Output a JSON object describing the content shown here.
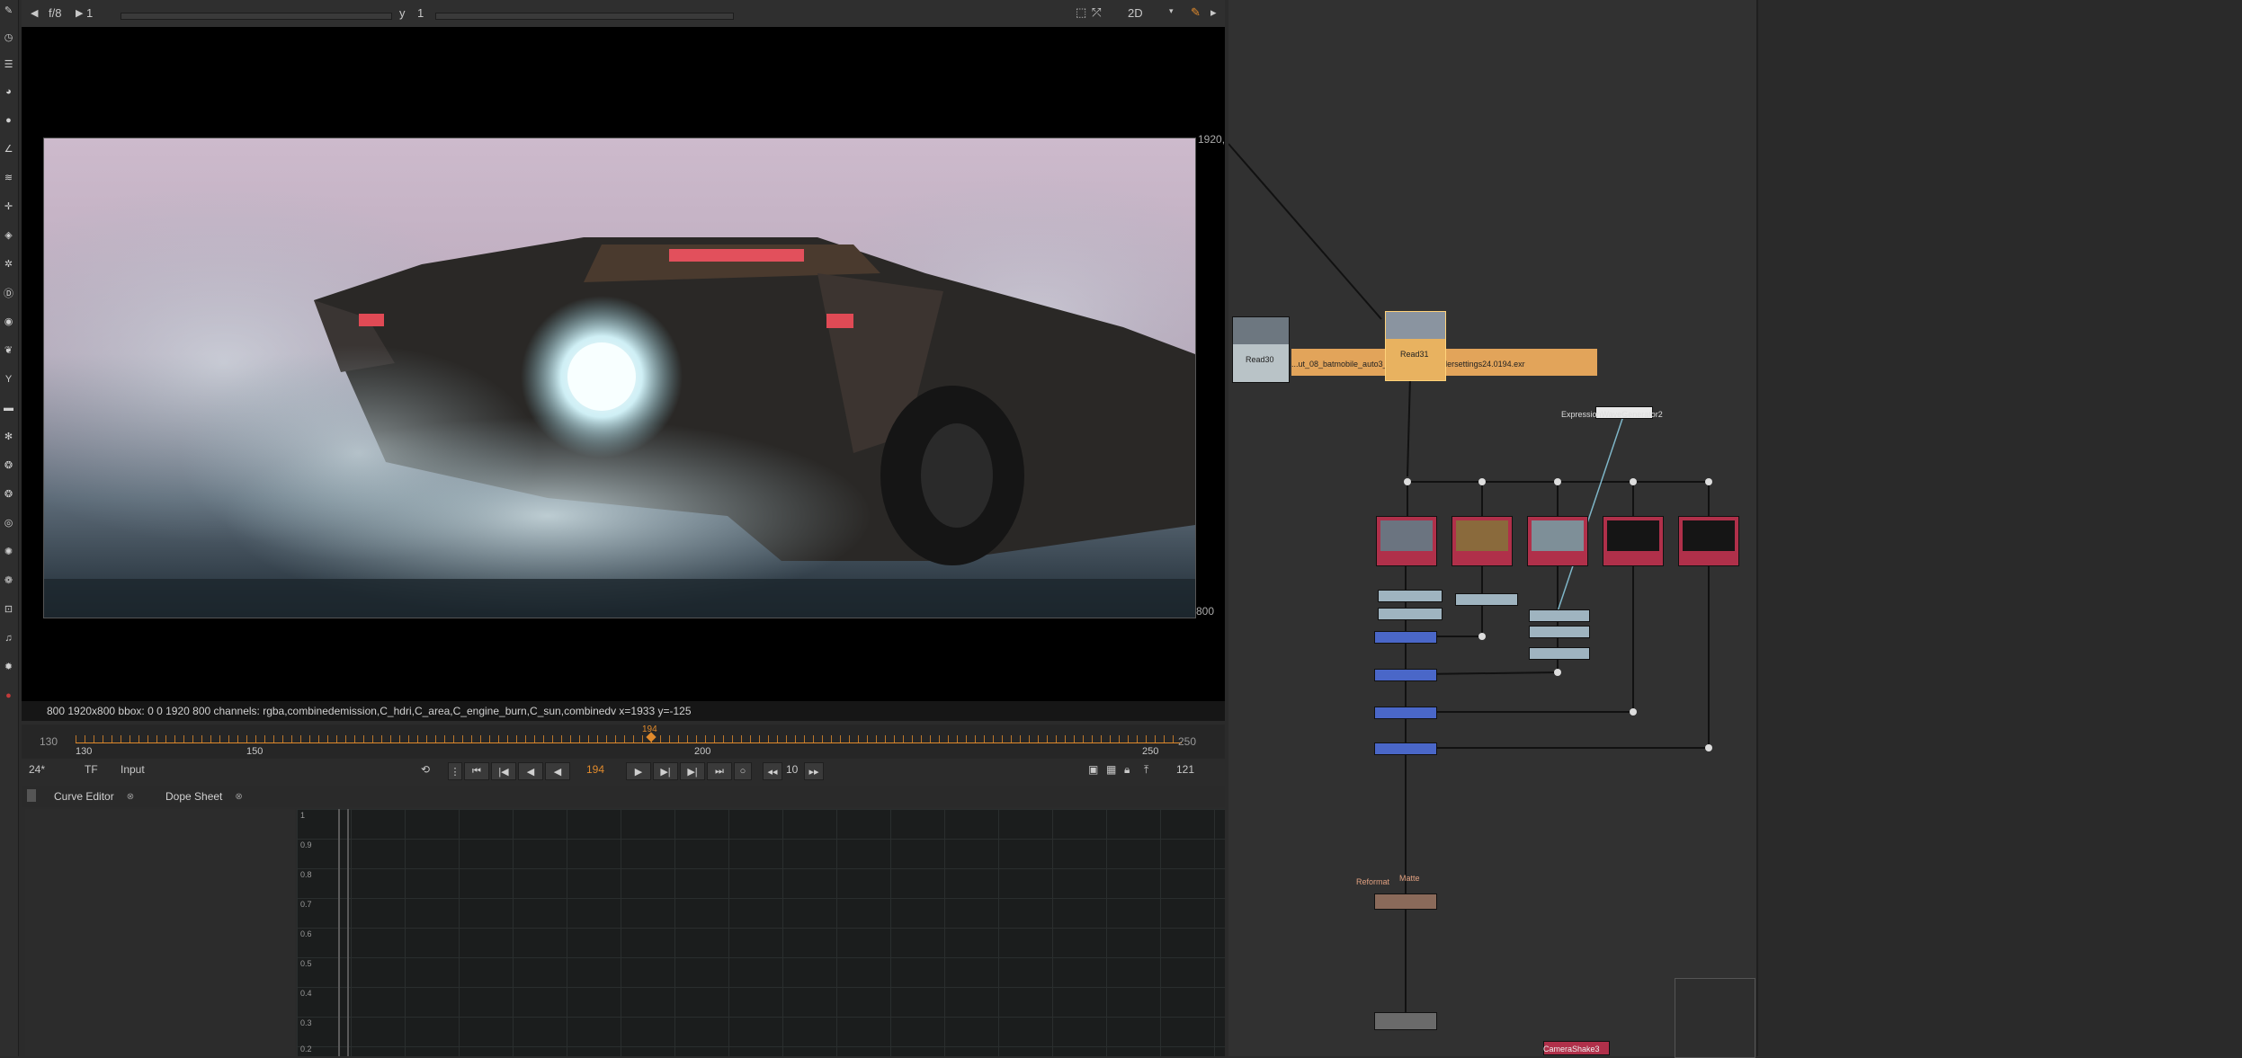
{
  "viewer": {
    "fstop": "f/8",
    "frame_a": "1",
    "y_label": "y",
    "y_value": "1",
    "view_mode": "2D",
    "format_label_right": "1920,",
    "format_label_bottom": "800",
    "info": "800 1920x800  bbox: 0 0 1920 800 channels: rgba,combinedemission,C_hdri,C_area,C_engine_burn,C_sun,combinedv  x=1933 y=-125"
  },
  "timeline": {
    "start": "130",
    "end": "250",
    "tick_labels": [
      "130",
      "150",
      "200",
      "250"
    ],
    "playhead": "194",
    "in_out_right": "250"
  },
  "transport": {
    "fps": "24*",
    "tf": "TF",
    "input": "Input",
    "current_frame": "194",
    "step": "10",
    "last_value": "121"
  },
  "tabs": [
    {
      "label": "Curve Editor"
    },
    {
      "label": "Dope Sheet"
    }
  ],
  "curve_editor": {
    "y_ticks": [
      "1",
      "0.9",
      "0.8",
      "0.7",
      "0.6",
      "0.5",
      "0.4",
      "0.3",
      "0.2"
    ]
  },
  "nodegraph": {
    "read30_label": "Read30",
    "read31_label": "Read31",
    "read_path": "...ut_08_batmobile_auto3_stuck.karmarendersettings24.0194.exr",
    "expression_node": "ExpressionWaveGenerator2",
    "matte_label": "Matte",
    "reformat_label": "Reformat",
    "camera_shake": "CameraShake3"
  },
  "colors": {
    "accent_orange": "#e08a2c",
    "node_red": "#b0304a",
    "node_blue": "#4a67c8",
    "read_orange": "#e2a45a"
  }
}
